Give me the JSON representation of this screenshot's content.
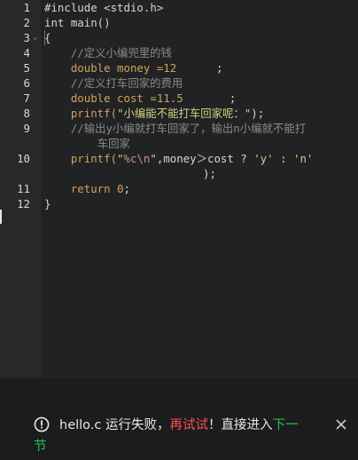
{
  "editor": {
    "lines": [
      {
        "n": "1",
        "parts": [
          {
            "t": "#include <stdio.h>",
            "c": "plain"
          }
        ]
      },
      {
        "n": "2",
        "parts": [
          {
            "t": "int main()",
            "c": "plain"
          }
        ]
      },
      {
        "n": "3",
        "parts": [
          {
            "t": "{",
            "c": "plain"
          }
        ],
        "fold": true
      },
      {
        "n": "4",
        "parts": [
          {
            "t": "    //定义小编兜里的钱",
            "c": "cmt"
          }
        ]
      },
      {
        "n": "5",
        "parts": [
          {
            "t": "    double money =",
            "c": "kw"
          },
          {
            "t": "12",
            "c": "num"
          },
          {
            "t": "      ;",
            "c": "plain"
          }
        ]
      },
      {
        "n": "6",
        "parts": [
          {
            "t": "    //定义打车回家的费用",
            "c": "cmt"
          }
        ]
      },
      {
        "n": "7",
        "parts": [
          {
            "t": "    double cost =",
            "c": "kw"
          },
          {
            "t": "11.5",
            "c": "num"
          },
          {
            "t": "       ;",
            "c": "plain"
          }
        ]
      },
      {
        "n": "8",
        "parts": [
          {
            "t": "    printf(",
            "c": "kw"
          },
          {
            "t": "\"小编能不能打车回家呢：\"",
            "c": "str"
          },
          {
            "t": ");",
            "c": "plain"
          }
        ]
      },
      {
        "n": "9",
        "parts": [
          {
            "t": "    //输出y小编就打车回家了，输出n小编就不能打",
            "c": "cmt"
          }
        ]
      },
      {
        "n": "",
        "parts": [
          {
            "t": "        车回家",
            "c": "cmt"
          }
        ]
      },
      {
        "n": "10",
        "parts": [
          {
            "t": "    printf(",
            "c": "kw"
          },
          {
            "t": "\"",
            "c": "str"
          },
          {
            "t": "%c\\n",
            "c": "esc"
          },
          {
            "t": "\"",
            "c": "str"
          },
          {
            "t": ",money＞cost ? ",
            "c": "plain"
          },
          {
            "t": "'y'",
            "c": "str"
          },
          {
            "t": " : ",
            "c": "plain"
          },
          {
            "t": "'n'",
            "c": "str"
          }
        ]
      },
      {
        "n": "",
        "parts": [
          {
            "t": "                        );",
            "c": "plain"
          }
        ]
      },
      {
        "n": "11",
        "parts": [
          {
            "t": "    return ",
            "c": "kw"
          },
          {
            "t": "0",
            "c": "num"
          },
          {
            "t": ";",
            "c": "plain"
          }
        ]
      },
      {
        "n": "12",
        "parts": [
          {
            "t": "}",
            "c": "plain"
          }
        ]
      }
    ]
  },
  "toast": {
    "icon": "alert-circle-icon",
    "prefix": "hello.c 运行失败，",
    "retry_label": "再试试",
    "middle": "！直接进入",
    "next_label_part1": "下一",
    "next_label_part2": "节",
    "close_icon": "close-icon",
    "colors": {
      "retry": "#ff4d4d",
      "next": "#27c24c"
    }
  }
}
